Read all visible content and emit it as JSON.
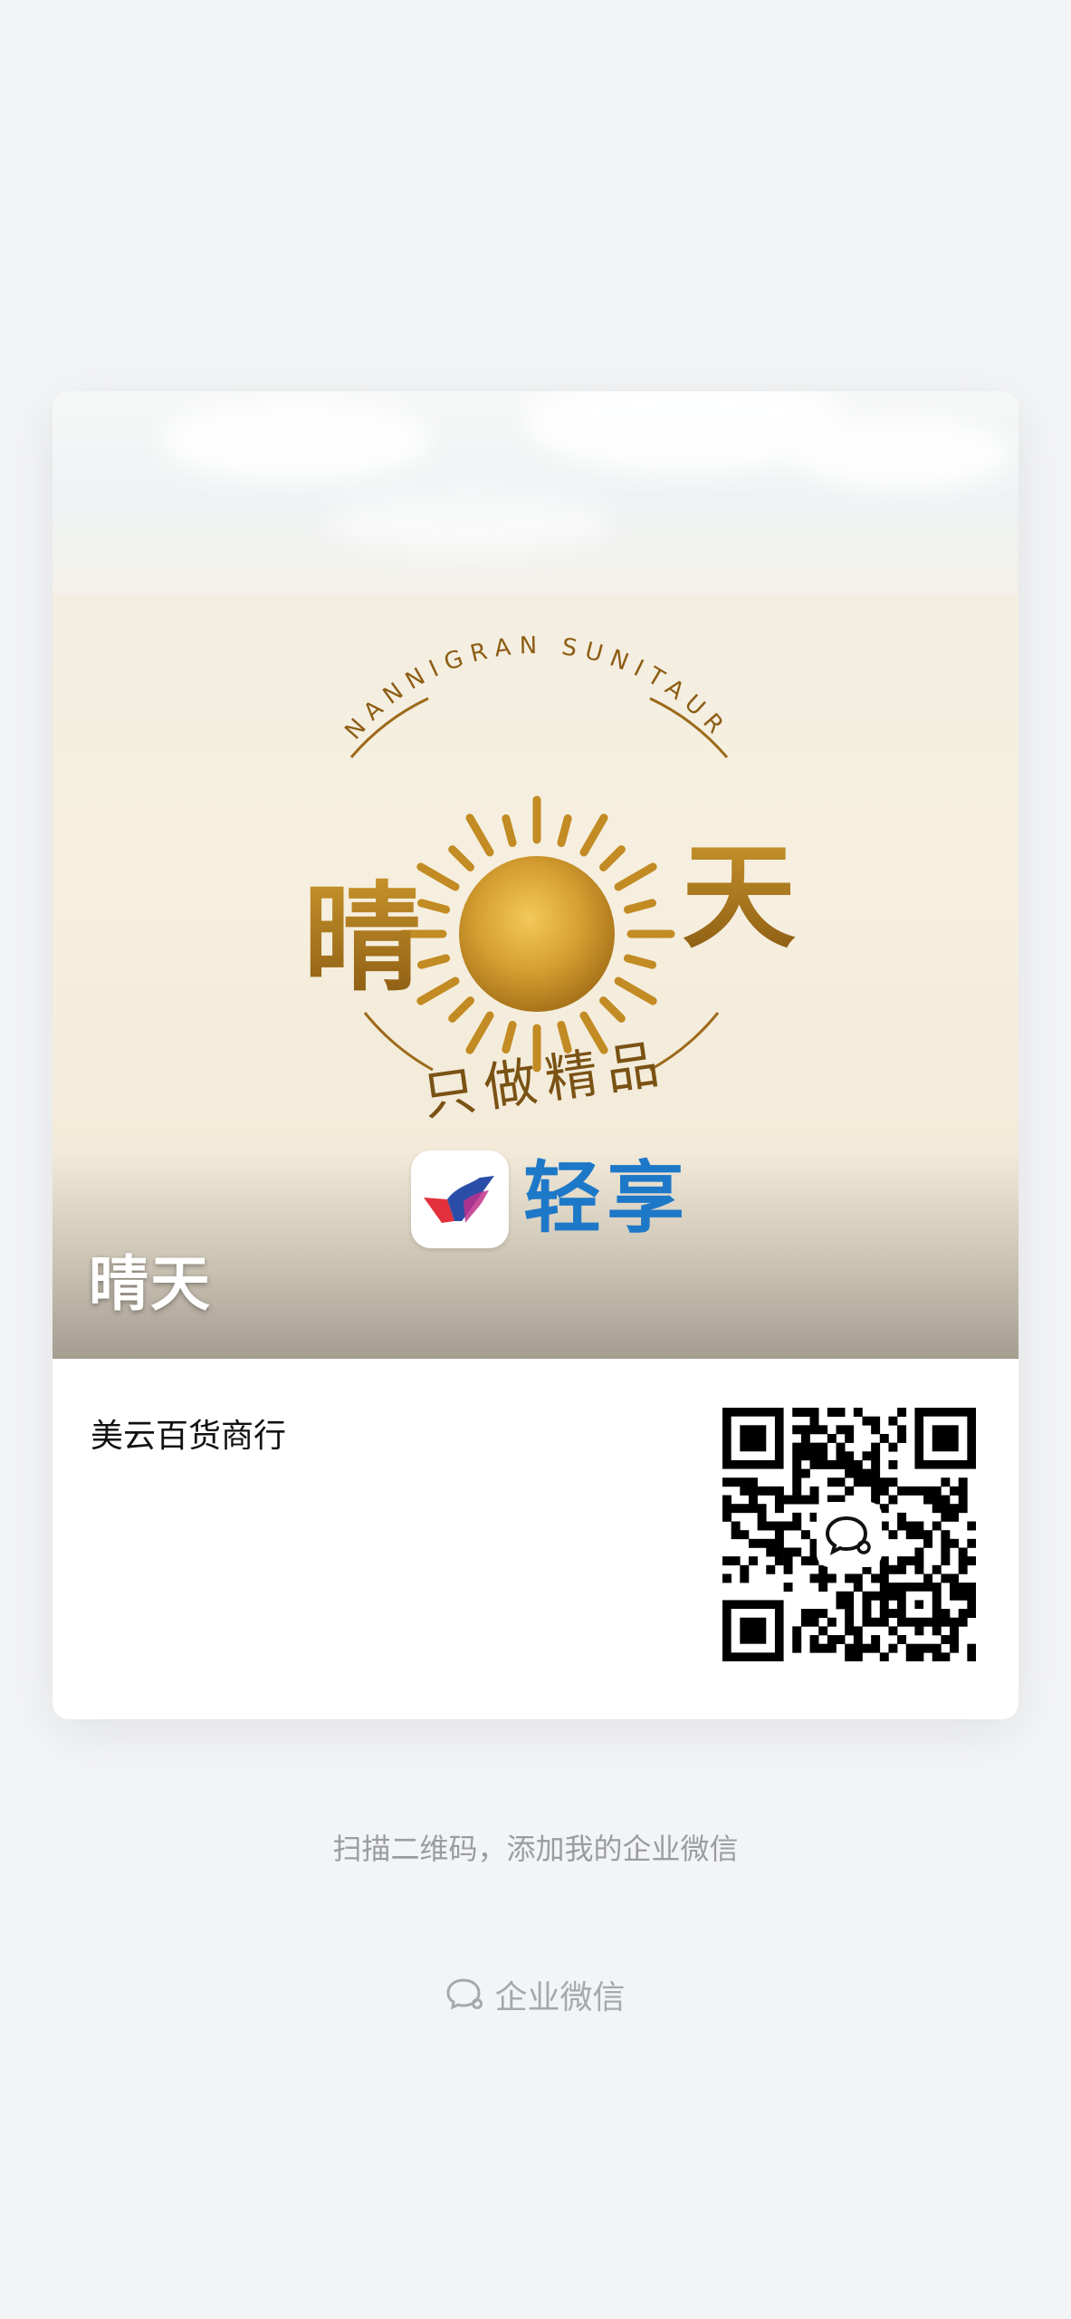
{
  "card": {
    "cover_title": "晴天",
    "logo": {
      "arc_text": "NANNIGRAN SUNITAUR",
      "left_char": "晴",
      "right_char": "天",
      "slogan": "只做精品"
    },
    "brand_name": "轻享",
    "company_name": "美云百货商行"
  },
  "hint_text": "扫描二维码，添加我的企业微信",
  "footer": {
    "icon": "wecom-icon",
    "label": "企业微信"
  },
  "colors": {
    "background": "#f3f4f6",
    "gold": "#b8831f",
    "brand_blue": "#1e78c8",
    "hint_gray": "#9a9ca1"
  }
}
